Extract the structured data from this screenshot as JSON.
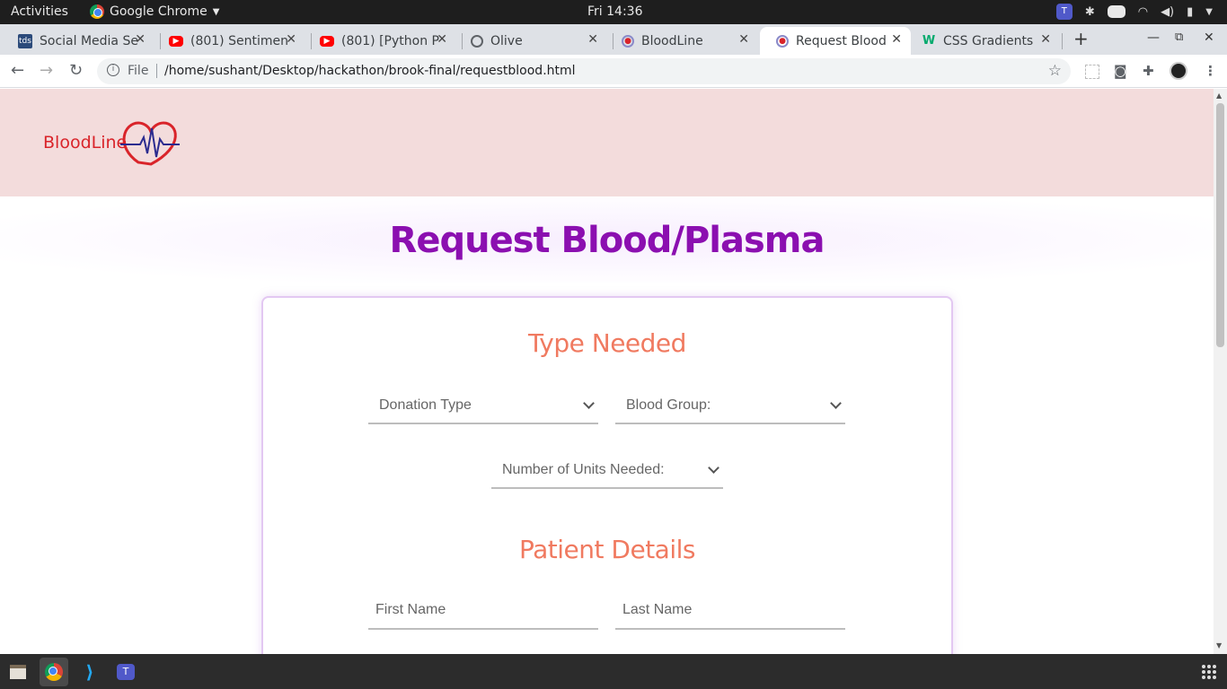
{
  "system": {
    "activities": "Activities",
    "app_name": "Google Chrome",
    "clock": "Fri 14:36"
  },
  "tabs": [
    {
      "title": "Social Media Se",
      "favicon": "tds-icon",
      "active": false
    },
    {
      "title": "(801) Sentimen",
      "favicon": "youtube-icon",
      "active": false
    },
    {
      "title": "(801) [Python P",
      "favicon": "youtube-icon",
      "active": false
    },
    {
      "title": "Olive",
      "favicon": "globe-icon",
      "active": false
    },
    {
      "title": "BloodLine",
      "favicon": "blood-drop-icon",
      "active": false
    },
    {
      "title": "Request Blood",
      "favicon": "blood-drop-icon",
      "active": true
    },
    {
      "title": "CSS Gradients",
      "favicon": "w3schools-icon",
      "active": false
    }
  ],
  "address_bar": {
    "scheme": "File",
    "url": "/home/sushant/Desktop/hackathon/brook-final/requestblood.html"
  },
  "site": {
    "logo_text": "BloodLine",
    "page_title": "Request Blood/Plasma"
  },
  "form": {
    "type_section_title": "Type Needed",
    "donation_type_label": "Donation Type",
    "blood_group_label": "Blood Group:",
    "units_label": "Number of Units Needed:",
    "patient_section_title": "Patient Details",
    "first_name_placeholder": "First Name",
    "last_name_placeholder": "Last Name"
  },
  "colors": {
    "header_bg": "#f3dcdc",
    "page_title": "#8b0fb0",
    "section_title": "#f07a60",
    "card_border": "#e3c8f2",
    "logo_red": "#d9242a",
    "logo_blue": "#2b2b8f"
  }
}
